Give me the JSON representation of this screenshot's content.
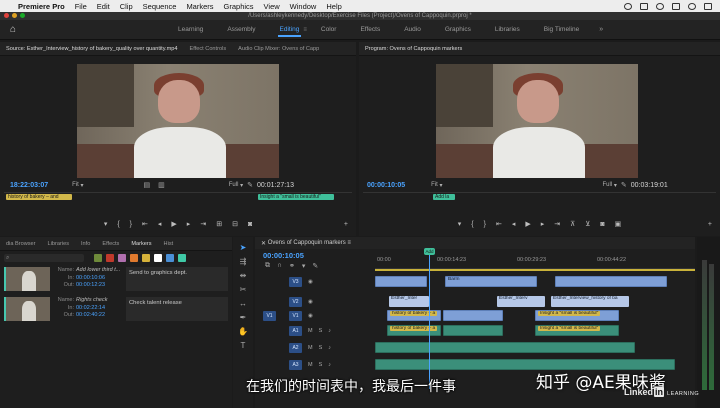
{
  "menubar": {
    "app": "Premiere Pro",
    "items": [
      "File",
      "Edit",
      "Clip",
      "Sequence",
      "Markers",
      "Graphics",
      "View",
      "Window",
      "Help"
    ]
  },
  "path": "/Users/ashleykennedy/Desktop/Exercise Files (Project)/Ovens of Cappoquin.prproj *",
  "workspaces": {
    "tabs": [
      "Learning",
      "Assembly",
      "Editing",
      "Color",
      "Effects",
      "Audio",
      "Graphics",
      "Libraries",
      "Big Timeline"
    ],
    "active": "Editing"
  },
  "source": {
    "tabs": [
      "Source: Esther_Interview_history of bakery_quality over quantity.mp4",
      "Effect Controls",
      "Audio Clip Mixer: Ovens of Capp"
    ],
    "timecode": "18:22:03:07",
    "zoom": "Fit",
    "resolution": "Full",
    "duration": "00:01:27:13",
    "marker_left": "history of bakery – and",
    "marker_right": "Insight a \"small is beautiful\""
  },
  "program": {
    "tab": "Program: Ovens of Cappoquin markers",
    "timecode": "00:00:10:05",
    "zoom": "Fit",
    "resolution": "Full",
    "duration": "00:03:19:01",
    "marker": "Add la"
  },
  "markers_panel": {
    "tabs": [
      "dia Browser",
      "Libraries",
      "Info",
      "Effects",
      "Markers",
      "Hist"
    ],
    "active": "Markers",
    "colors": [
      "#6e8a3a",
      "#c0392b",
      "#b06fae",
      "#e07a2e",
      "#d6b23a",
      "#ffffff",
      "#4a8fd6",
      "#3fc9a6"
    ],
    "items": [
      {
        "name": "Add lower third t...",
        "in": "00:00:10:06",
        "out": "00:00:12:23",
        "comment": "Send to graphics dept."
      },
      {
        "name": "Rights check",
        "in": "00:02:22:14",
        "out": "00:02:40:22",
        "comment": "Check talent release"
      }
    ],
    "labels": {
      "name": "Name:",
      "in": "In:",
      "out": "Out:"
    }
  },
  "timeline": {
    "title": "Ovens of Cappoquin markers",
    "timecode": "00:00:10:05",
    "ruler": [
      "00:00",
      "00:00:14:23",
      "00:00:29:23",
      "00:00:44:22"
    ],
    "playhead_label": "Add",
    "video_tracks": [
      "V3",
      "V2",
      "V1"
    ],
    "audio_tracks": [
      "A1",
      "A2",
      "A3"
    ],
    "clip_labels": {
      "v3": "Barm",
      "v2a": "Esther_Inter",
      "v2b": "Esther_Interv",
      "v2c": "Esther_Interview_history of ba",
      "v1lbl1": "history of bakery – a",
      "v1lbl2": "Insight a \"small is beautiful\"",
      "a1lbl1": "history of bakery – a",
      "a1lbl2": "Insight a \"small is beautiful\""
    }
  },
  "subtitle": "在我们的时间表中，我最后一件事",
  "watermark": "知乎 @AE果味酱",
  "brand": {
    "linked": "Linked",
    "in": "in",
    "learning": "LEARNING"
  }
}
